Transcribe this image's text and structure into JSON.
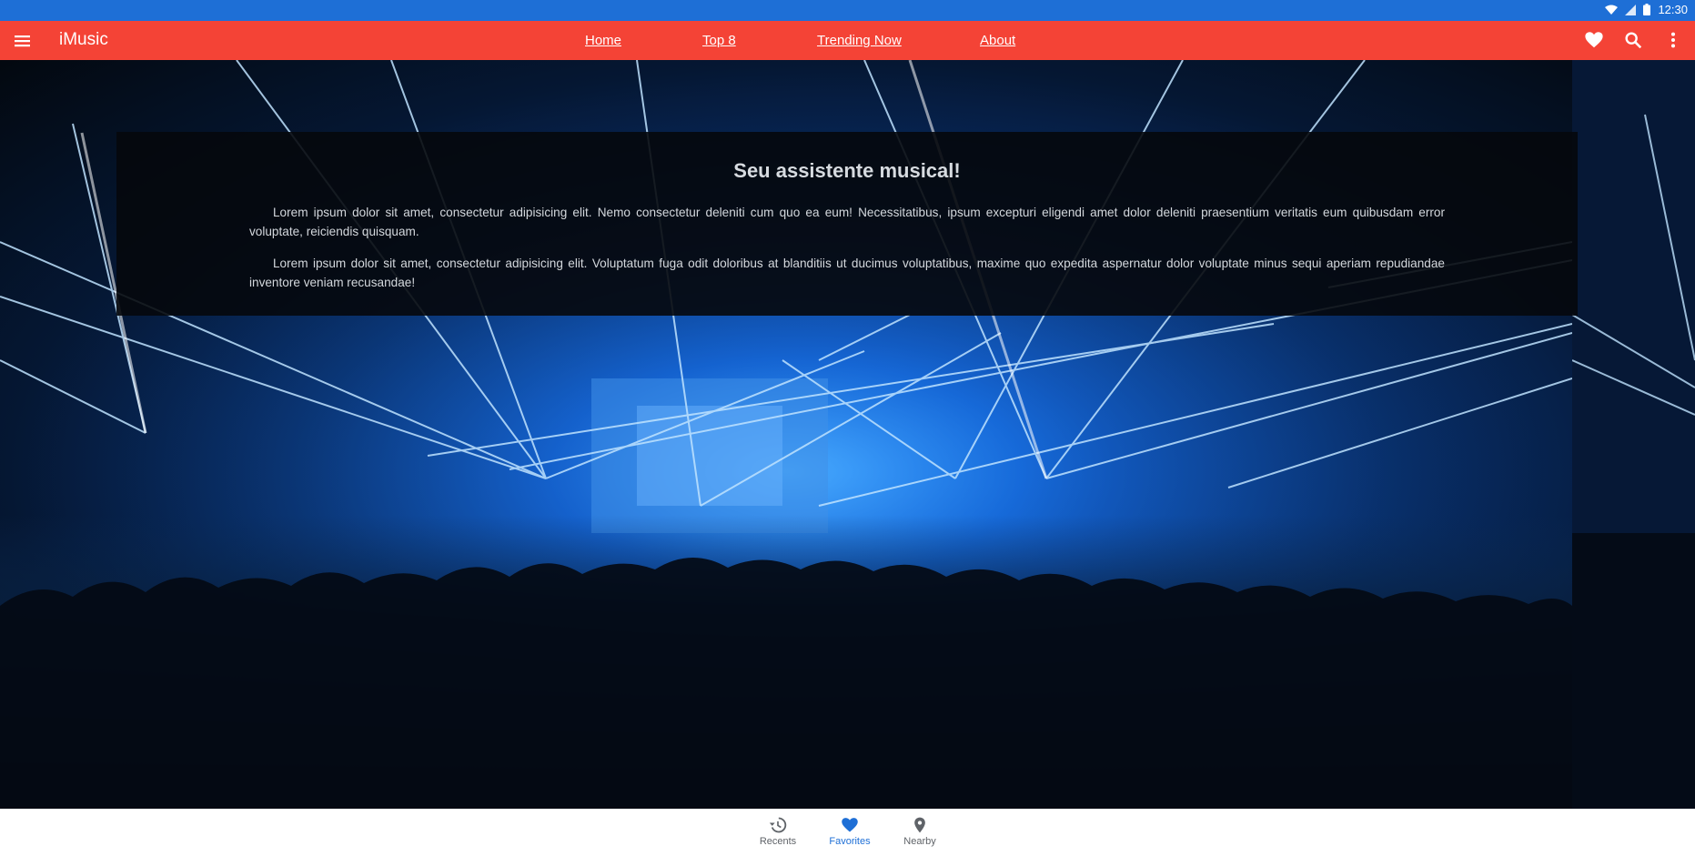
{
  "status_bar": {
    "time": "12:30"
  },
  "app_bar": {
    "title": "iMusic",
    "nav_links": [
      "Home",
      "Top 8",
      "Trending Now",
      "About"
    ],
    "actions": [
      "heart-icon",
      "search-icon",
      "more-vert-icon"
    ],
    "color": "#f44336"
  },
  "hero": {
    "heading": "Seu assistente musical!",
    "paragraphs": [
      "Lorem ipsum dolor sit amet, consectetur adipisicing elit. Nemo consectetur deleniti cum quo ea eum! Necessitatibus, ipsum excepturi eligendi amet dolor deleniti praesentium veritatis eum quibusdam error voluptate, reiciendis quisquam.",
      "Lorem ipsum dolor sit amet, consectetur adipisicing elit. Voluptatum fuga odit doloribus at blanditiis ut ducimus voluptatibus, maxime quo expedita aspernatur dolor voluptate minus sequi aperiam repudiandae inventore veniam recusandae!"
    ]
  },
  "bottom_nav": {
    "items": [
      {
        "label": "Recents",
        "icon": "history-icon",
        "active": false
      },
      {
        "label": "Favorites",
        "icon": "heart-icon",
        "active": true
      },
      {
        "label": "Nearby",
        "icon": "location-pin-icon",
        "active": false
      }
    ],
    "accent": "#1e6fd6"
  },
  "colors": {
    "status_bar": "#1e6fd6",
    "app_bar": "#f44336"
  }
}
